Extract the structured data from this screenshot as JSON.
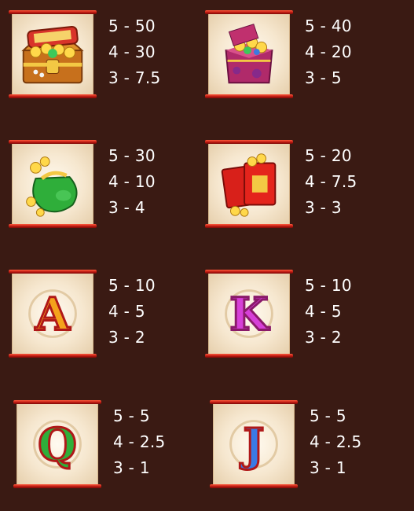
{
  "paytable": [
    {
      "symbol": "treasure-chest",
      "pays": [
        "5 - 50",
        "4 - 30",
        "3 - 7.5"
      ]
    },
    {
      "symbol": "gift-box-of-gold",
      "pays": [
        "5 - 40",
        "4 - 20",
        "3 - 5"
      ]
    },
    {
      "symbol": "jade-money-bag",
      "pays": [
        "5 - 30",
        "4 - 10",
        "3 - 4"
      ]
    },
    {
      "symbol": "red-envelopes",
      "pays": [
        "5 - 20",
        "4 - 7.5",
        "3 - 3"
      ]
    },
    {
      "symbol": "letter-A",
      "glyph": "A",
      "pays": [
        "5 - 10",
        "4 - 5",
        "3 - 2"
      ]
    },
    {
      "symbol": "letter-K",
      "glyph": "K",
      "pays": [
        "5 - 10",
        "4 - 5",
        "3 - 2"
      ]
    },
    {
      "symbol": "letter-Q",
      "glyph": "Q",
      "pays": [
        "5 - 5",
        "4 - 2.5",
        "3 - 1"
      ]
    },
    {
      "symbol": "letter-J",
      "glyph": "J",
      "pays": [
        "5 - 5",
        "4 - 2.5",
        "3 - 1"
      ]
    }
  ],
  "colors": {
    "background": "#3a1a13",
    "scroll_rod": "#c41a12",
    "pay_text": "#ffffff"
  }
}
